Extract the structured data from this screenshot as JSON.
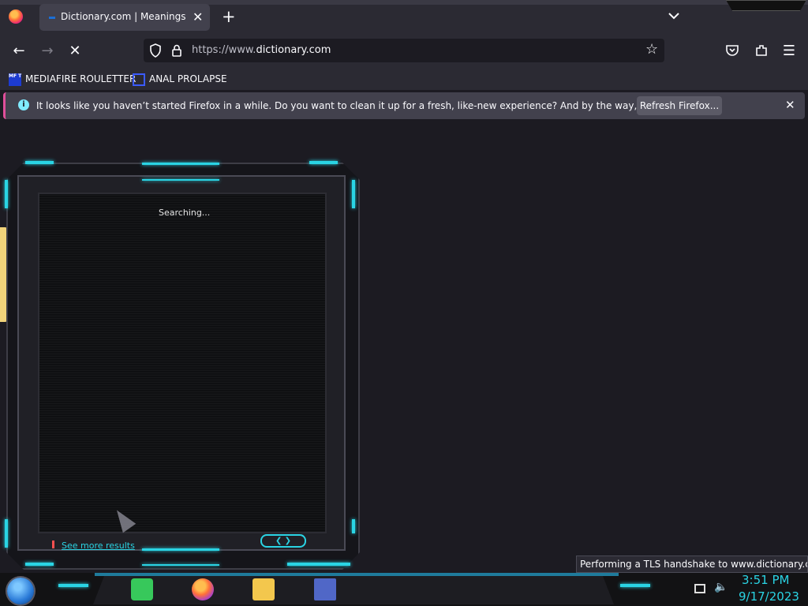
{
  "browser": {
    "tab": {
      "title": "Dictionary.com | Meanings & Definitions",
      "close": "✕"
    },
    "new_tab": "+",
    "url": {
      "prefix": "https://www.",
      "domain": "dictionary.com"
    },
    "bookmarks": [
      {
        "label": "MEDIAFIRE ROULETTER",
        "icon_text": "MF T"
      },
      {
        "label": "ANAL PROLAPSE"
      }
    ],
    "notification": {
      "message": "It looks like you haven’t started Firefox in a while. Do you want to clean it up for a fresh, like-new experience? And by the way, welcome back!",
      "button": "Refresh Firefox...",
      "close": "✕"
    },
    "status": "Performing a TLS handshake to www.dictionary.com..."
  },
  "overlay": {
    "searching": "Searching...",
    "see_more": "See more results",
    "nav_pill": "❮ ❯"
  },
  "taskbar": {
    "time": "3:51 PM",
    "date": "9/17/2023"
  },
  "icons": {
    "back": "←",
    "forward": "→",
    "stop": "✕",
    "star": "☆",
    "menu": "☰",
    "volume": "🔈"
  },
  "colors": {
    "accent_cyan": "#2ad4e4",
    "chrome_bg": "#2b2a33",
    "content_bg": "#1c1b22",
    "notification_bg": "#42414d"
  }
}
